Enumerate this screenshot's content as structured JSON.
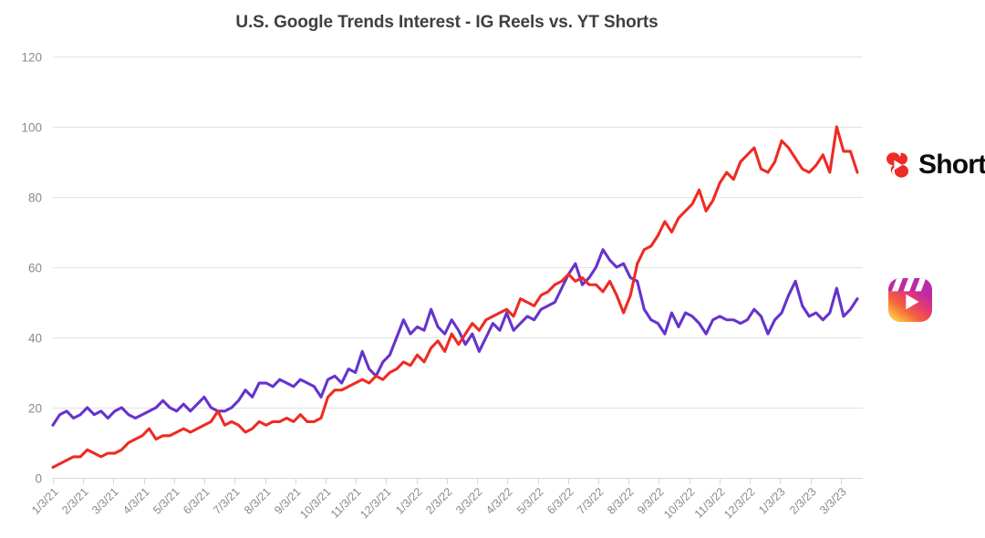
{
  "chart_data": {
    "type": "line",
    "title": "U.S. Google Trends Interest - IG Reels vs. YT Shorts",
    "xlabel": "",
    "ylabel": "",
    "ylim": [
      0,
      120
    ],
    "ytick_labels": [
      "0",
      "20",
      "40",
      "60",
      "80",
      "100",
      "120"
    ],
    "yticks": [
      0,
      20,
      40,
      60,
      80,
      100,
      120
    ],
    "grid": true,
    "legend_position": "right",
    "categories": [
      "1/3/21",
      "2/3/21",
      "3/3/21",
      "4/3/21",
      "5/3/21",
      "6/3/21",
      "7/3/21",
      "8/3/21",
      "9/3/21",
      "10/3/21",
      "11/3/21",
      "12/3/21",
      "1/3/22",
      "2/3/22",
      "3/3/22",
      "4/3/22",
      "5/3/22",
      "6/3/22",
      "7/3/22",
      "8/3/22",
      "9/3/22",
      "10/3/22",
      "11/3/22",
      "12/3/22",
      "1/3/23",
      "2/3/23",
      "3/3/23"
    ],
    "series": [
      {
        "name": "IG Reels",
        "color": "#6633CC",
        "legend_icon": "instagram-reels-icon",
        "values": [
          15,
          18,
          19,
          17,
          18,
          20,
          18,
          19,
          17,
          19,
          20,
          18,
          17,
          18,
          19,
          20,
          22,
          20,
          19,
          21,
          19,
          21,
          23,
          20,
          19,
          19,
          20,
          22,
          25,
          23,
          27,
          27,
          26,
          28,
          27,
          26,
          28,
          27,
          26,
          23,
          28,
          29,
          27,
          31,
          30,
          36,
          31,
          29,
          33,
          35,
          40,
          45,
          41,
          43,
          42,
          48,
          43,
          41,
          45,
          42,
          38,
          41,
          36,
          40,
          44,
          42,
          47,
          42,
          44,
          46,
          45,
          48,
          49,
          50,
          54,
          58,
          61,
          55,
          57,
          60,
          65,
          62,
          60,
          61,
          57,
          56,
          48,
          45,
          44,
          41,
          47,
          43,
          47,
          46,
          44,
          41,
          45,
          46,
          45,
          45,
          44,
          45,
          48,
          46,
          41,
          45,
          47,
          52,
          56,
          49,
          46,
          47,
          45,
          47,
          54,
          46,
          48,
          51
        ]
      },
      {
        "name": "YT Shorts",
        "color": "#EE2B24",
        "legend_icon": "youtube-shorts-icon",
        "legend_label": "Shorts",
        "values": [
          3,
          4,
          5,
          6,
          6,
          8,
          7,
          6,
          7,
          7,
          8,
          10,
          11,
          12,
          14,
          11,
          12,
          12,
          13,
          14,
          13,
          14,
          15,
          16,
          19,
          15,
          16,
          15,
          13,
          14,
          16,
          15,
          16,
          16,
          17,
          16,
          18,
          16,
          16,
          17,
          23,
          25,
          25,
          26,
          27,
          28,
          27,
          29,
          28,
          30,
          31,
          33,
          32,
          35,
          33,
          37,
          39,
          36,
          41,
          38,
          41,
          44,
          42,
          45,
          46,
          47,
          48,
          46,
          51,
          50,
          49,
          52,
          53,
          55,
          56,
          58,
          56,
          57,
          55,
          55,
          53,
          56,
          52,
          47,
          52,
          61,
          65,
          66,
          69,
          73,
          70,
          74,
          76,
          78,
          82,
          76,
          79,
          84,
          87,
          85,
          90,
          92,
          94,
          88,
          87,
          90,
          96,
          94,
          91,
          88,
          87,
          89,
          92,
          87,
          100,
          93,
          93,
          87
        ]
      }
    ]
  }
}
